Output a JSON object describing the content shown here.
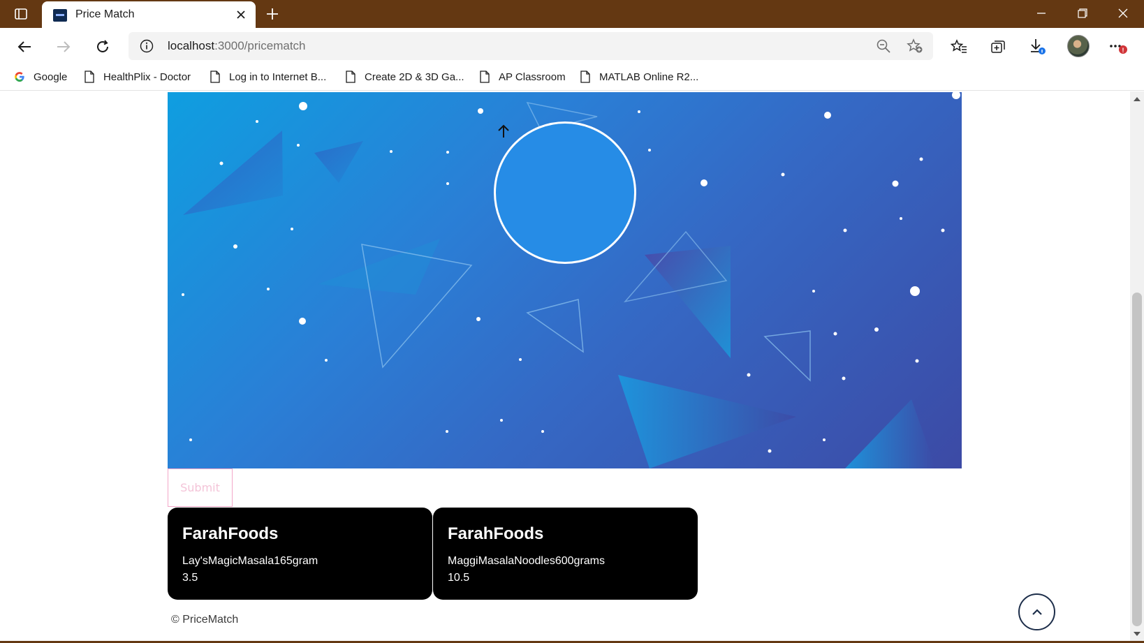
{
  "browser": {
    "tab_title": "Price Match",
    "url_host": "localhost",
    "url_path": ":3000/pricematch",
    "bookmarks": [
      {
        "label": "Google",
        "icon": "google-icon"
      },
      {
        "label": "HealthPlix - Doctor",
        "icon": "page-icon"
      },
      {
        "label": "Log in to Internet B...",
        "icon": "page-icon"
      },
      {
        "label": "Create 2D & 3D Ga...",
        "icon": "page-icon"
      },
      {
        "label": "AP Classroom",
        "icon": "page-icon"
      },
      {
        "label": "MATLAB Online R2...",
        "icon": "page-icon"
      }
    ],
    "colors": {
      "titlebar": "#643812",
      "notification_badge": "#d13438",
      "download_badge": "#1a73e8"
    }
  },
  "page": {
    "upload_icon": "arrow-up-icon",
    "submit_label": "Submit",
    "cards": [
      {
        "store": "FarahFoods",
        "product": "Lay'sMagicMasala165gram",
        "price": "3.5"
      },
      {
        "store": "FarahFoods",
        "product": "MaggiMasalaNoodles600grams",
        "price": "10.5"
      }
    ],
    "footer": "© PriceMatch",
    "scroll_top_icon": "chevron-up-icon",
    "colors": {
      "hero_start": "#0f9ee0",
      "hero_end": "#3c4aa5",
      "upload_circle": "#268ce6",
      "card_bg": "#000000",
      "submit_border": "#f3a7c9"
    }
  }
}
